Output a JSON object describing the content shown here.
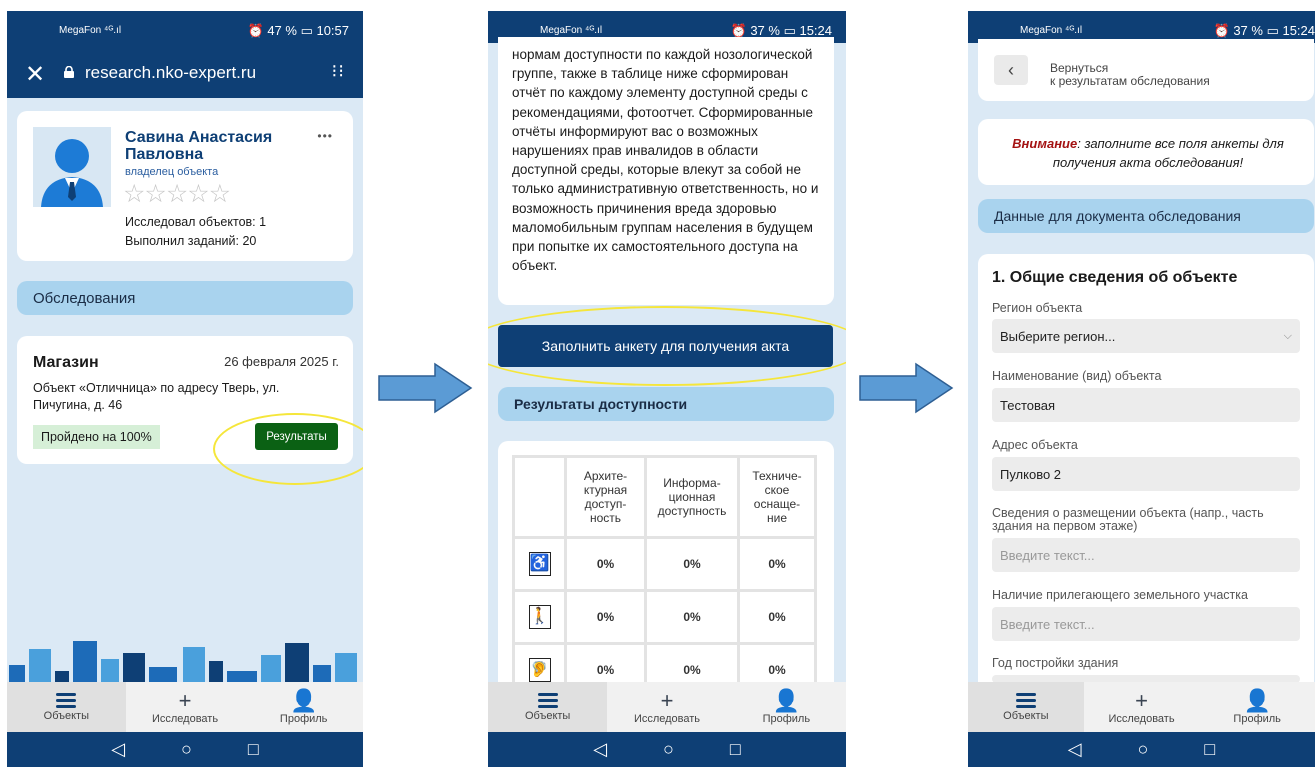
{
  "screens": [
    {
      "statusbar": {
        "carrier": "MegaFon ⁴ᴳ.ıl",
        "right": "⏰ 47 % ▭ 10:57"
      },
      "urlbar": {
        "url": "research.nko-expert.ru"
      },
      "profile": {
        "name": "Савина Анастасия Павловна",
        "role": "владелец объекта",
        "rating_stars": 0,
        "stars": "☆☆☆☆☆",
        "objects_studied": "Исследовал объектов: 1",
        "tasks_done": "Выполнил заданий: 20",
        "more": "•••"
      },
      "section_title": "Обследования",
      "survey": {
        "title": "Магазин",
        "date": "26 февраля 2025 г.",
        "description": "Объект «Отличница» по адресу Тверь, ул. Пичугина, д. 46",
        "progress": "Пройдено на 100%",
        "results_button": "Результаты"
      },
      "nav": [
        {
          "label": "Объекты"
        },
        {
          "label": "Исследовать"
        },
        {
          "label": "Профиль"
        }
      ]
    },
    {
      "statusbar": {
        "carrier": "MegaFon ⁴ᴳ.ıl",
        "right": "⏰ 37 % ▭ 15:24"
      },
      "body_text": "нормам доступности по каждой нозологической группе, также в таблице ниже сформирован отчёт по каждому элементу доступной среды с рекомендациями, фотоотчет. Сформированные отчёты информируют вас о возможных нарушениях прав инвалидов в области доступной среды, которые влекут за собой не только административную ответственность, но и возможность причинения вреда здоровью маломобильным группам населения в будущем при попытке их самостоятельного доступа на объект.",
      "fill_button": "Заполнить анкету для получения акта",
      "results_title": "Результаты доступности",
      "table_headers": [
        "Архите-\nктурная\nдоступ-\nность",
        "Информа-\nционная\nдоступность",
        "Техниче-\nское\nоснаще-\nние"
      ],
      "rows": [
        {
          "icon": "wheelchair-icon",
          "values": [
            "0%",
            "0%",
            "0%"
          ]
        },
        {
          "icon": "blind-person-icon",
          "values": [
            "0%",
            "0%",
            "0%"
          ]
        },
        {
          "icon": "hearing-impaired-icon",
          "values": [
            "0%",
            "0%",
            "0%"
          ]
        }
      ],
      "nav": [
        {
          "label": "Объекты"
        },
        {
          "label": "Исследовать"
        },
        {
          "label": "Профиль"
        }
      ]
    },
    {
      "statusbar": {
        "carrier": "MegaFon ⁴ᴳ.ıl",
        "right": "⏰ 37 % ▭ 15:24"
      },
      "back": {
        "line1": "Вернуться",
        "line2": "к результатам обследования"
      },
      "warning_label": "Внимание",
      "warning_text": ": заполните все поля анкеты для получения акта обследования!",
      "doc_data_title": "Данные для документа обследования",
      "form_title": "1. Общие сведения об объекте",
      "fields": {
        "region_label": "Регион объекта",
        "region_value": "Выберите регион...",
        "name_label": "Наименование (вид) объекта",
        "name_value": "Тестовая",
        "address_label": "Адрес объекта",
        "address_value": "Пулково 2",
        "placement_label": "Сведения о размещении объекта (напр., часть здания на первом этаже)",
        "placement_placeholder": "Введите текст...",
        "land_label": "Наличие прилегающего земельного участка",
        "land_placeholder": "Введите текст...",
        "year_label": "Год постройки здания"
      },
      "nav": [
        {
          "label": "Объекты"
        },
        {
          "label": "Исследовать"
        },
        {
          "label": "Профиль"
        }
      ]
    }
  ],
  "colors": {
    "navy": "#0e3f75",
    "light_blue": "#a9d3ee",
    "green": "#0b6114",
    "red": "#a41212",
    "highlight": "#f5e63a"
  }
}
